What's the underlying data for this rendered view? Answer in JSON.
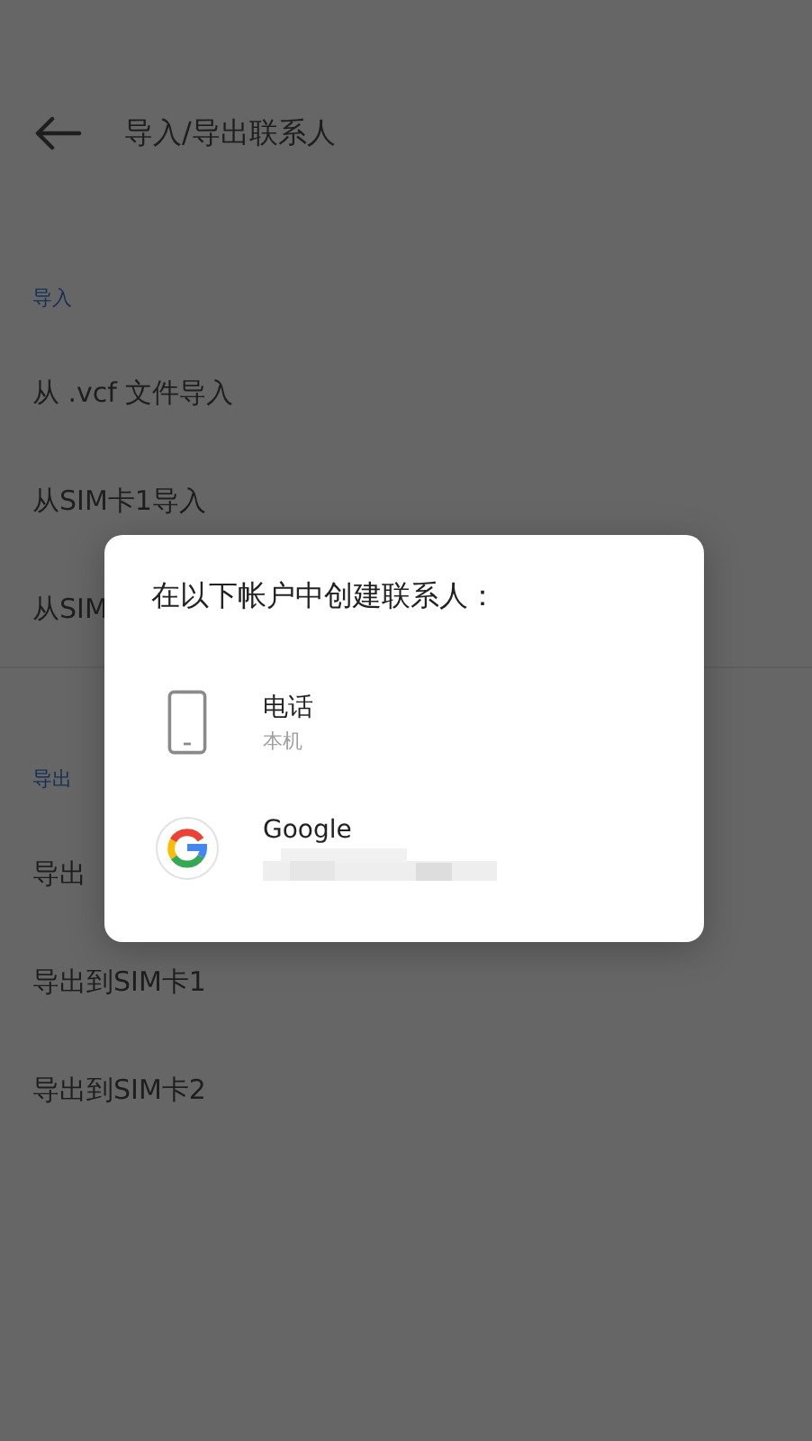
{
  "header": {
    "title": "导入/导出联系人"
  },
  "sections": [
    {
      "title": "导入",
      "items": [
        "从 .vcf 文件导入",
        "从SIM卡1导入",
        "从SIM"
      ]
    },
    {
      "title": "导出",
      "items": [
        "导出",
        "导出到SIM卡1",
        "导出到SIM卡2"
      ]
    }
  ],
  "dialog": {
    "title": "在以下帐户中创建联系人：",
    "accounts": [
      {
        "kind": "phone",
        "name": "电话",
        "detail": "本机"
      },
      {
        "kind": "google",
        "name": "Google"
      }
    ]
  }
}
